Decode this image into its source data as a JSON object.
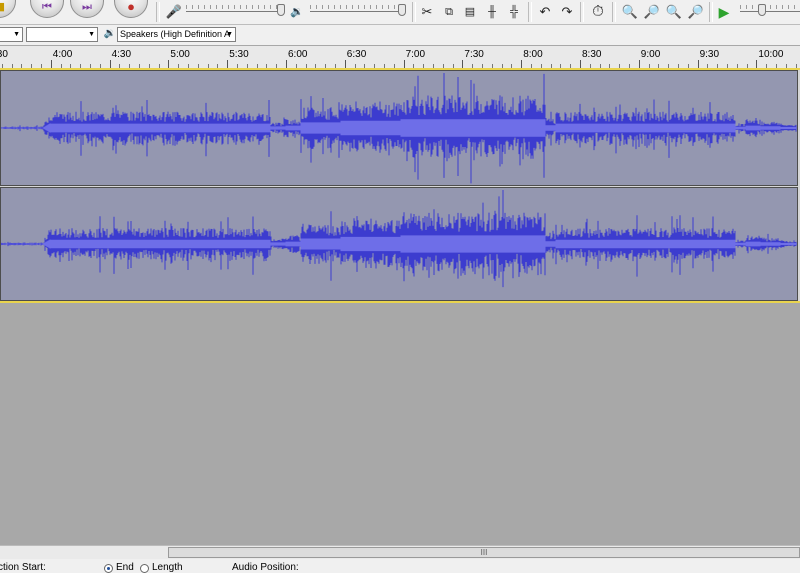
{
  "toolbar": {
    "mic_icon": "microphone-icon",
    "speaker_icon": "speaker-icon",
    "buttons": [
      "pause-icon",
      "skip-start-icon",
      "skip-end-icon",
      "record-icon"
    ]
  },
  "devices": {
    "input_host": "",
    "input_device": "",
    "output_device": "Speakers (High Definition A"
  },
  "ruler": {
    "labels": [
      ":30",
      "4:00",
      "4:30",
      "5:00",
      "5:30",
      "6:00",
      "6:30",
      "7:00",
      "7:30",
      "8:00",
      "8:30",
      "9:00",
      "9:30",
      "10:00"
    ]
  },
  "scrollbar": {
    "grip": "III"
  },
  "status": {
    "selection_start": "ction Start:",
    "end_label": "End",
    "length_label": "Length",
    "audio_position": "Audio Position:",
    "end_selected": true
  },
  "colors": {
    "waveform": "#3c3ccf",
    "waveform_rms": "#6e6ee8",
    "track_bg": "#9497b0",
    "empty_area": "#a8a8a8"
  }
}
